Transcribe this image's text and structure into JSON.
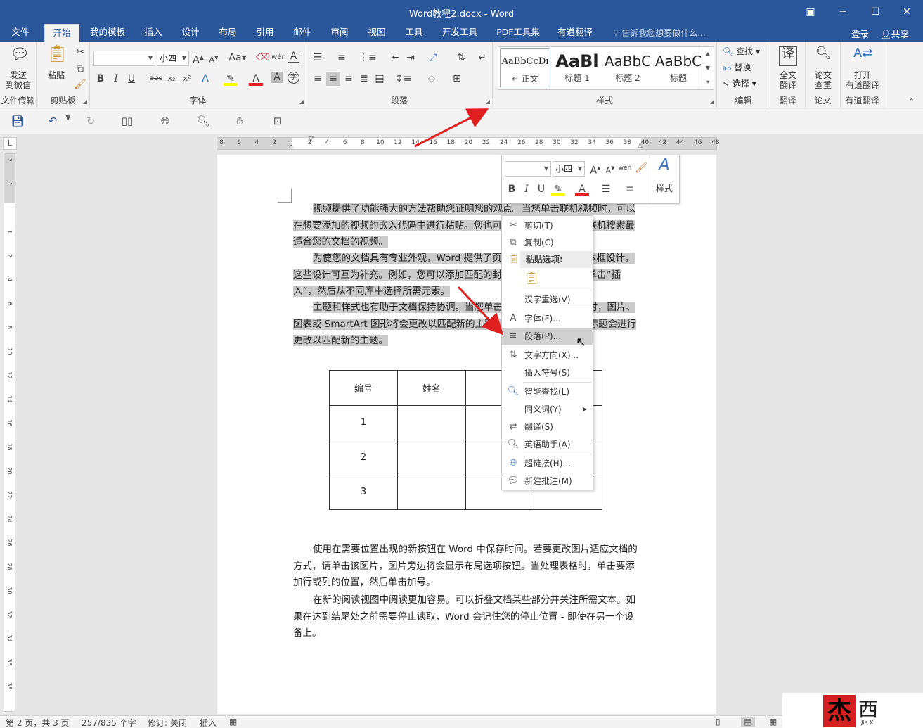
{
  "window": {
    "title": "Word教程2.docx - Word"
  },
  "menu": {
    "tabs": [
      "文件",
      "开始",
      "我的模板",
      "插入",
      "设计",
      "布局",
      "引用",
      "邮件",
      "审阅",
      "视图",
      "工具",
      "开发工具",
      "PDF工具集",
      "有道翻译"
    ],
    "tell_me": "告诉我您想要做什么...",
    "login": "登录",
    "share": "共享"
  },
  "ribbon": {
    "send_label": "发送\n到微信",
    "file_transfer_label": "文件传输",
    "paste_label": "粘贴",
    "clipboard_label": "剪贴板",
    "font_size_value": "小四",
    "font_label": "字体",
    "paragraph_label": "段落",
    "styles_label": "样式",
    "style_items": [
      {
        "sample": "AaBbCcDı",
        "name": "↵ 正文"
      },
      {
        "sample": "AaBl",
        "name": "标题 1"
      },
      {
        "sample": "AaBbC",
        "name": "标题 2"
      },
      {
        "sample": "AaBbC",
        "name": "标题"
      }
    ],
    "find_label": "查找",
    "replace_label": "替换",
    "select_label": "选择",
    "editing_label": "编辑",
    "full_translate_label": "全文\n翻译",
    "translate_group_label": "翻译",
    "paper_check_label": "论文\n查重",
    "paper_group_label": "论文",
    "open_youdao_label": "打开\n有道翻译",
    "youdao_group_label": "有道翻译"
  },
  "ruler": {
    "h_ticks": [
      "8",
      "6",
      "4",
      "2",
      "",
      "2",
      "4",
      "6",
      "8",
      "10",
      "12",
      "14",
      "16",
      "18",
      "20",
      "22",
      "24",
      "26",
      "28",
      "30",
      "32",
      "34",
      "36",
      "38",
      "40",
      "42",
      "44",
      "46",
      "48"
    ],
    "v_ticks": [
      "2",
      "1",
      "",
      "1",
      "2",
      "4",
      "6",
      "8",
      "10",
      "12",
      "14",
      "16",
      "18",
      "20",
      "22",
      "24",
      "26",
      "28",
      "30",
      "32",
      "34",
      "36",
      "38"
    ]
  },
  "document": {
    "para1": "视频提供了功能强大的方法帮助您证明您的观点。当您单击联机视频时，可以在想要添加的视频的嵌入代码中进行粘贴。您也可以键入一个关键字以联机搜索最适合您的文档的视频。",
    "para2": "为使您的文档具有专业外观，Word 提供了页眉、页脚、封面和文本框设计，这些设计可互为补充。例如，您可以添加匹配的封面、页眉和提要栏。单击“插入”，然后从不同库中选择所需元素。",
    "para3": "主题和样式也有助于文档保持协调。当您单击设计并选择新的主题时，图片、图表或 SmartArt 图形将会更改以匹配新的主题。当应用样式时，您的标题会进行更改以匹配新的主题。",
    "table": {
      "headers": [
        "编号",
        "姓名",
        "",
        ""
      ],
      "rows": [
        [
          "1",
          "",
          "",
          ""
        ],
        [
          "2",
          "",
          "",
          ""
        ],
        [
          "3",
          "",
          "",
          ""
        ]
      ]
    },
    "para4": "使用在需要位置出现的新按钮在 Word 中保存时间。若要更改图片适应文档的方式，请单击该图片，图片旁边将会显示布局选项按钮。当处理表格时，单击要添加行或列的位置，然后单击加号。",
    "para5": "在新的阅读视图中阅读更加容易。可以折叠文档某些部分并关注所需文本。如果在达到结尾处之前需要停止读取，Word 会记住您的停止位置 - 即使在另一个设备上。"
  },
  "mini_toolbar": {
    "font_size": "小四",
    "styles_label": "样式"
  },
  "context_menu": {
    "cut": "剪切(T)",
    "copy": "复制(C)",
    "paste_options": "粘贴选项:",
    "hanzi_reselect": "汉字重选(V)",
    "font": "字体(F)...",
    "paragraph": "段落(P)...",
    "text_direction": "文字方向(X)...",
    "insert_symbol": "插入符号(S)",
    "smart_lookup": "智能查找(L)",
    "synonyms": "同义词(Y)",
    "translate": "翻译(S)",
    "english_assistant": "英语助手(A)",
    "hyperlink": "超链接(H)...",
    "new_comment": "新建批注(M)"
  },
  "status": {
    "page": "第 2 页，共 3 页",
    "words": "257/835 个字",
    "track_changes": "修订: 关闭",
    "insert_mode": "插入"
  },
  "watermark": {
    "brand": "杰西",
    "sub": "Jie Xi"
  },
  "colors": {
    "brand": "#2b579a",
    "arrow": "#e02020",
    "selection": "#cbcbcb"
  }
}
